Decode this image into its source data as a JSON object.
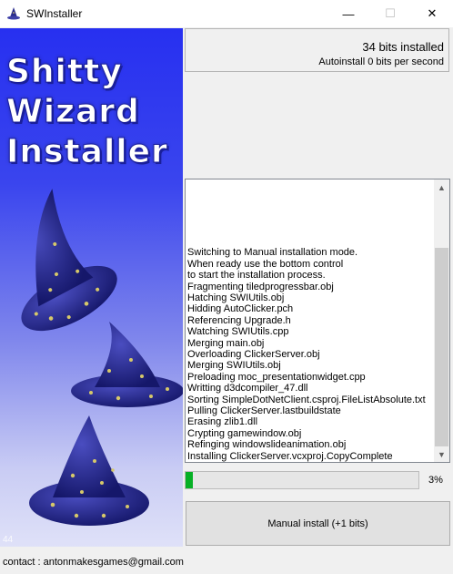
{
  "window": {
    "title": "SWInstaller",
    "controls": {
      "minimize": "—",
      "maximize": "☐",
      "close": "✕"
    }
  },
  "banner": {
    "title_lines": [
      "Shitty",
      "Wizard",
      "Installer"
    ],
    "counter": "44"
  },
  "status": {
    "bits_installed": "34 bits installed",
    "rate": "Autoinstall 0 bits per second"
  },
  "log": {
    "lines": [
      "Switching to Manual installation mode.",
      "When ready use the bottom control",
      "to start the installation process.",
      "Fragmenting tiledprogressbar.obj",
      "Hatching SWIUtils.obj",
      "Hidding AutoClicker.pch",
      "Referencing Upgrade.h",
      "Watching SWIUtils.cpp",
      "Merging main.obj",
      "Overloading ClickerServer.obj",
      "Merging SWIUtils.obj",
      "Preloading moc_presentationwidget.cpp",
      "Writting d3dcompiler_47.dll",
      "Sorting SimpleDotNetClient.csproj.FileListAbsolute.txt",
      "Pulling ClickerServer.lastbuildstate",
      "Erasing zlib1.dll",
      "Crypting gamewindow.obj",
      "Refinging windowslideanimation.obj",
      "Installing ClickerServer.vcxproj.CopyComplete"
    ],
    "scroll_up_icon": "▲",
    "scroll_down_icon": "▼"
  },
  "progress": {
    "value_percent": 3,
    "label": "3%",
    "fill_color": "#06b025"
  },
  "manual_button": {
    "label": "Manual install (+1 bits)"
  },
  "footer": {
    "contact": "contact : antonmakesgames@gmail.com"
  },
  "icons": {
    "app": "wizard-hat-icon",
    "banner_art": "wizard-hats-illustration"
  },
  "colors": {
    "banner_top": "#2730f0",
    "banner_bottom": "#dfe1f8",
    "hat": "#2a2c8c",
    "stars": "#d6c86a"
  }
}
